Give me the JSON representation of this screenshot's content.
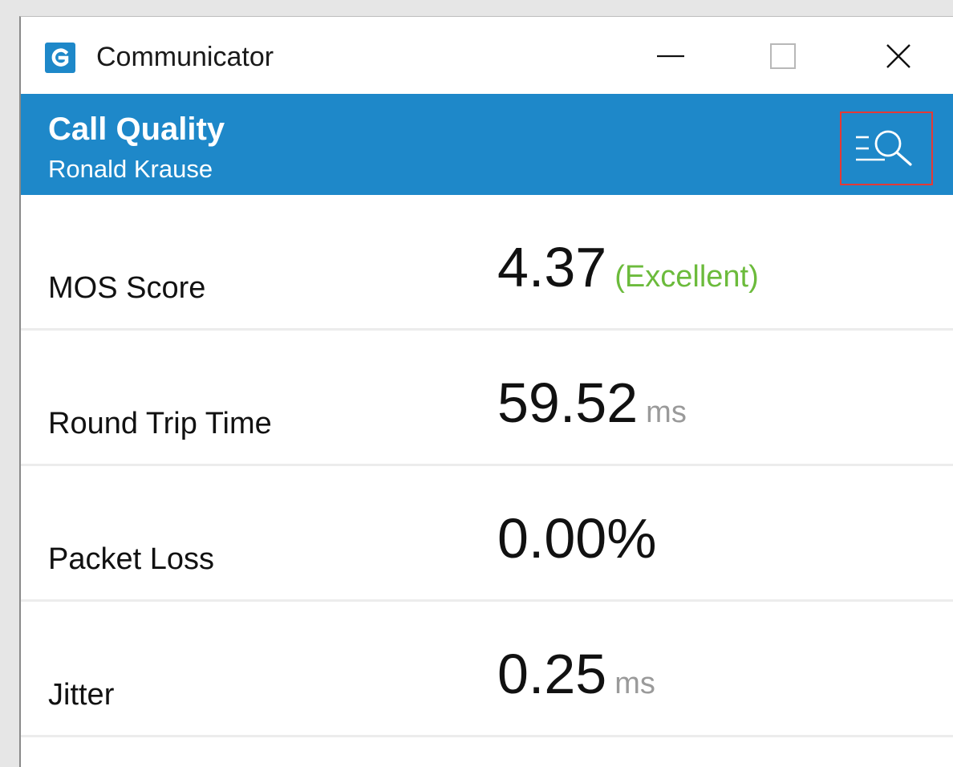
{
  "window": {
    "title": "Communicator"
  },
  "header": {
    "title": "Call Quality",
    "subtitle": "Ronald Krause"
  },
  "metrics": [
    {
      "label": "MOS Score",
      "value": "4.37",
      "unit": "(Excellent)"
    },
    {
      "label": "Round Trip Time",
      "value": "59.52",
      "unit": "ms"
    },
    {
      "label": "Packet Loss",
      "value": "0.00%",
      "unit": ""
    },
    {
      "label": "Jitter",
      "value": "0.25",
      "unit": "ms"
    }
  ],
  "colors": {
    "accent": "#1e88c9",
    "status_good": "#6cbb3c",
    "highlight_border": "#e53935"
  },
  "icons": {
    "app": "communicator-logo-icon",
    "minimize": "minimize-icon",
    "maximize": "maximize-icon",
    "close": "close-icon",
    "details": "details-search-icon"
  }
}
